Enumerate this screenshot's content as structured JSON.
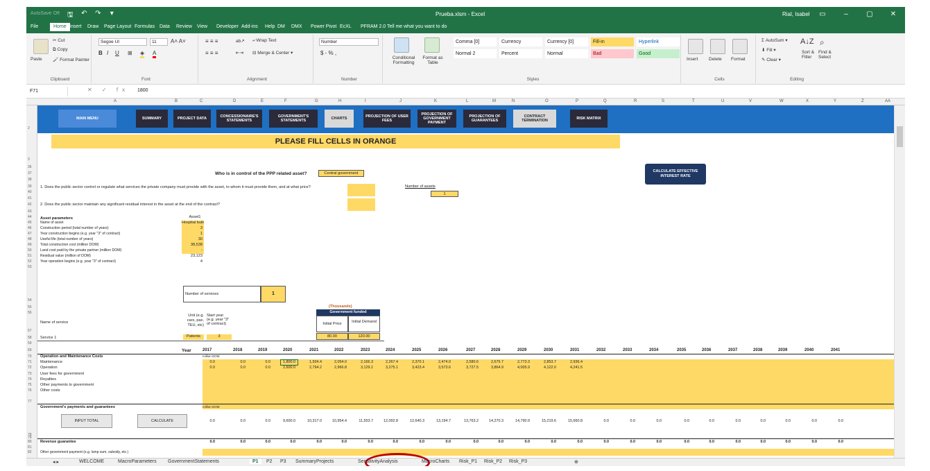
{
  "window": {
    "title": "Prueba.xlsm - Excel",
    "user": "Rial, Isabel",
    "autosave": "AutoSave",
    "autosave_state": "Off",
    "accent": "#217346"
  },
  "tabs": [
    "File",
    "Home",
    "Insert",
    "Draw",
    "Page Layout",
    "Formulas",
    "Data",
    "Review",
    "View",
    "Developer",
    "Add-ins",
    "Help",
    "DM",
    "DMX",
    "Power Pivot",
    "EcXL",
    "PFRAM 2.0",
    "Tell me what you want to do"
  ],
  "ribbon": {
    "clipboard": {
      "cut": "Cut",
      "copy": "Copy",
      "paste": "Paste",
      "format_painter": "Format Painter",
      "label": "Clipboard"
    },
    "font": {
      "name": "Segoe UI",
      "size": "11",
      "label": "Font"
    },
    "alignment": {
      "wrap": "Wrap Text",
      "merge": "Merge & Center",
      "label": "Alignment"
    },
    "number": {
      "format": "Number",
      "label": "Number",
      "symbols": "$ - % ,"
    },
    "styles": {
      "conditional": "Conditional Formatting",
      "format_table": "Format as Table",
      "cells": [
        {
          "text": "Comma [0]",
          "bg": "#ffffff",
          "color": "#222222"
        },
        {
          "text": "Currency",
          "bg": "#ffffff",
          "color": "#222222"
        },
        {
          "text": "Currency [0]",
          "bg": "#ffffff",
          "color": "#222222"
        },
        {
          "text": "Fill-in",
          "bg": "#ffd966",
          "color": "#222222"
        },
        {
          "text": "Hyperlink",
          "bg": "#ffffff",
          "color": "#0563c1"
        },
        {
          "text": "Normal 2",
          "bg": "#ffffff",
          "color": "#222222"
        },
        {
          "text": "Percent",
          "bg": "#ffffff",
          "color": "#222222"
        },
        {
          "text": "Normal",
          "bg": "#ffffff",
          "color": "#222222"
        },
        {
          "text": "Bad",
          "bg": "#ffc7ce",
          "color": "#9c0006"
        },
        {
          "text": "Good",
          "bg": "#c6efce",
          "color": "#006100"
        }
      ],
      "label": "Styles"
    },
    "cells_group": {
      "insert": "Insert",
      "delete": "Delete",
      "format": "Format",
      "label": "Cells"
    },
    "editing": {
      "autosum": "AutoSum",
      "fill": "Fill",
      "clear": "Clear",
      "sort": "Sort & Filter",
      "find": "Find & Select",
      "label": "Editing"
    }
  },
  "formula_bar": {
    "cell": "F71",
    "fx": "fx",
    "value": "1800"
  },
  "columns": [
    "A",
    "B",
    "C",
    "D",
    "E",
    "F",
    "G",
    "H",
    "I",
    "J",
    "K",
    "L",
    "M",
    "N",
    "O",
    "P",
    "Q",
    "R",
    "S",
    "T",
    "U",
    "V",
    "W",
    "X",
    "Y",
    "Z",
    "AA"
  ],
  "nav_buttons": [
    {
      "label": "MAIN MENU",
      "style": "blue"
    },
    {
      "label": "SUMMARY",
      "style": "dark"
    },
    {
      "label": "PROJECT DATA",
      "style": "dark"
    },
    {
      "label": "CONCESSIONAIRE'S STATEMENTS",
      "style": "dark"
    },
    {
      "label": "GOVERNMENT'S STATEMENTS",
      "style": "dark"
    },
    {
      "label": "CHARTS",
      "style": "light"
    },
    {
      "label": "PROJECTION OF USER FEES",
      "style": "dark"
    },
    {
      "label": "PROJECTION OF GOVERNMENT PAYMENT",
      "style": "dark"
    },
    {
      "label": "PROJECTION OF GUARANTEES",
      "style": "dark"
    },
    {
      "label": "CONTRACT TERMINATION",
      "style": "light"
    },
    {
      "label": "RISK MATRIX",
      "style": "dark"
    }
  ],
  "banner": "PLEASE FILL CELLS IN ORANGE",
  "control": {
    "question": "Who is in control of the PPP related asset?",
    "answer": "Central government",
    "q1": "1. Does the public sector control or regulate what services the private company must provide with the asset, to whom it must provide them, and at what price?",
    "q2": "2. Does the public sector maintain any significant residual interest in the asset at the end of the contract?",
    "num_assets_label": "Number of assets",
    "num_assets": "1",
    "calc_rate": "CALCULATE EFFECTIVE INTEREST RATE"
  },
  "asset": {
    "header": "Asset parameters",
    "col": "Asset1",
    "rows": [
      {
        "label": "Name of asset",
        "value": "Hospital building"
      },
      {
        "label": "Construction period (total number of years)",
        "value": "3"
      },
      {
        "label": "Year construction begins (e.g. year \"3\" of contract)",
        "value": "1"
      },
      {
        "label": "Useful life (total number of years)",
        "value": "30"
      },
      {
        "label": "Total construction cost (million DOM)",
        "value": "38,538"
      },
      {
        "label": "Land cost paid by the private partner (million DOM)",
        "value": "-"
      },
      {
        "label": "Residual value (million of DOM)",
        "value": "23,123"
      },
      {
        "label": "Year operation begins (e.g. year \"3\" of contract)",
        "value": "4"
      }
    ]
  },
  "services": {
    "num_label": "Number of services",
    "num": "1",
    "thousands": "(Thousands)",
    "gov_funded": "Government funded",
    "name_col": "Name of service",
    "unit_col": "Unit (e.g. cars, pax, TEU, etc)",
    "start_col": "Start year (e.g. year \"3\" of contract)",
    "price_col": "Initial Price",
    "demand_col": "Initial Demand",
    "row": {
      "name": "Service 1",
      "unit": "Patients",
      "start": "3",
      "price": "80.00",
      "demand": "120.00"
    }
  },
  "years": [
    "2017",
    "2018",
    "2019",
    "2020",
    "2021",
    "2022",
    "2023",
    "2024",
    "2025",
    "2026",
    "2027",
    "2028",
    "2029",
    "2030",
    "2031",
    "2032",
    "2033",
    "2034",
    "2035",
    "2036",
    "2037",
    "2038",
    "2039",
    "2040",
    "2041"
  ],
  "year_label": "Year",
  "om": {
    "header": "Operation and Maintenance Costs",
    "unit": "million DOM",
    "maintenance_label": "Maintenance",
    "maintenance": [
      "0.0",
      "0.0",
      "0.0",
      "1,800.0",
      "1,934.4",
      "2,054.0",
      "2,166.3",
      "2,267.4",
      "2,370.1",
      "2,474.0",
      "2,580.6",
      "2,675.7",
      "2,773.3",
      "2,853.7",
      "2,936.4"
    ],
    "operation_label": "Operation",
    "operation": [
      "0.0",
      "0.0",
      "0.0",
      "2,600.0",
      "2,794.2",
      "2,966.8",
      "3,129.1",
      "3,275.1",
      "3,423.4",
      "3,573.6",
      "3,727.5",
      "3,864.9",
      "4,005.9",
      "4,122.0",
      "4,241.5"
    ],
    "other_rows": [
      "User fees for government",
      "Royalties",
      "Other payments to government",
      "Other costs"
    ]
  },
  "gov": {
    "header": "Government's payments and guarantees",
    "unit": "million DOM",
    "input_total": "INPUT TOTAL",
    "calculate": "CALCULATE",
    "values": [
      "0.0",
      "0.0",
      "0.0",
      "9,600.0",
      "10,317.0",
      "10,954.4",
      "11,553.7",
      "12,092.8",
      "12,640.3",
      "13,194.7",
      "13,763.2",
      "14,270.3",
      "14,790.9",
      "15,219.6",
      "15,660.8",
      "0.0",
      "0.0",
      "0.0",
      "0.0",
      "0.0",
      "0.0",
      "0.0",
      "0.0",
      "0.0",
      "0.0"
    ]
  },
  "revenue": {
    "label": "Revenue guarantee",
    "values": [
      "0.0",
      "0.0",
      "0.0",
      "0.0",
      "0.0",
      "0.0",
      "0.0",
      "0.0",
      "0.0",
      "0.0",
      "0.0",
      "0.0",
      "0.0",
      "0.0",
      "0.0",
      "0.0",
      "0.0",
      "0.0",
      "0.0",
      "0.0",
      "0.0",
      "0.0",
      "0.0",
      "0.0",
      "0.0"
    ]
  },
  "other_gov": "Other government payment (e.g. lump sum, subsidy, etc.)",
  "sheet_tabs": [
    "WELCOME",
    "MacroParameters",
    "GovernmentStatements",
    "P1",
    "P2",
    "P3",
    "SummaryProjects",
    "SensitivityAnalysis",
    "MacroCharts",
    "Risk_P1",
    "Risk_P2",
    "Risk_P3"
  ],
  "active_sheet": "P1"
}
